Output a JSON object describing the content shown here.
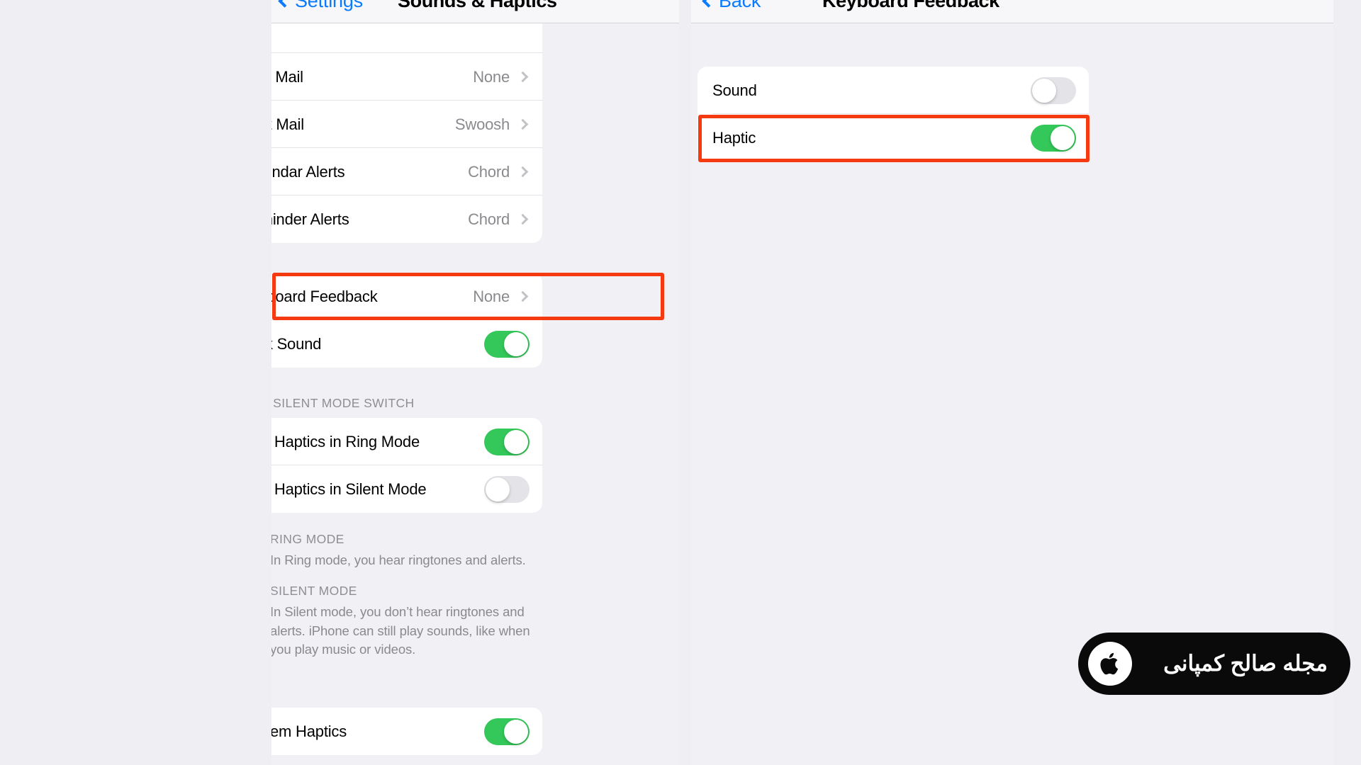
{
  "left_panel": {
    "nav": {
      "back_label": "Settings",
      "title": "Sounds & Haptics",
      "back_icon": "chevron-left-icon"
    },
    "sound_rows": [
      {
        "label": "New Mail",
        "value": "None"
      },
      {
        "label": "Sent Mail",
        "value": "Swoosh"
      },
      {
        "label": "Calendar Alerts",
        "value": "Chord"
      },
      {
        "label": "Reminder Alerts",
        "value": "Chord"
      }
    ],
    "keyboard_group": {
      "keyboard_feedback": {
        "label": "Keyboard Feedback",
        "value": "None"
      },
      "lock_sound": {
        "label": "Lock Sound",
        "state": "on"
      }
    },
    "ring_silent": {
      "header": "RING / SILENT MODE SWITCH",
      "rows": [
        {
          "label": "Play Haptics in Ring Mode",
          "state": "on"
        },
        {
          "label": "Play Haptics in Silent Mode",
          "state": "off"
        }
      ]
    },
    "footnotes": [
      {
        "icon": "bell-icon",
        "title": "RING MODE",
        "body": "In Ring mode, you hear ringtones and alerts."
      },
      {
        "icon": "bell-slash-icon",
        "title": "SILENT MODE",
        "body": "In Silent mode, you don’t hear ringtones and alerts. iPhone can still play sounds, like when you play music or videos."
      }
    ],
    "system_haptics": {
      "label": "System Haptics",
      "state": "on"
    }
  },
  "right_panel": {
    "nav": {
      "back_label": "Back",
      "title": "Keyboard Feedback",
      "back_icon": "chevron-left-icon"
    },
    "rows": [
      {
        "label": "Sound",
        "state": "off"
      },
      {
        "label": "Haptic",
        "state": "on"
      }
    ]
  },
  "watermark": {
    "text": "مجله صالح کمپانی",
    "icon": "apple-logo-icon"
  },
  "colors": {
    "accent_blue": "#0a7bff",
    "toggle_on": "#34c759",
    "toggle_off": "#e4e3e7",
    "highlight_red": "#f53a12",
    "panel_bg": "#f1f0f5",
    "card_bg": "#ffffff",
    "secondary_text": "#8a8a8e"
  }
}
